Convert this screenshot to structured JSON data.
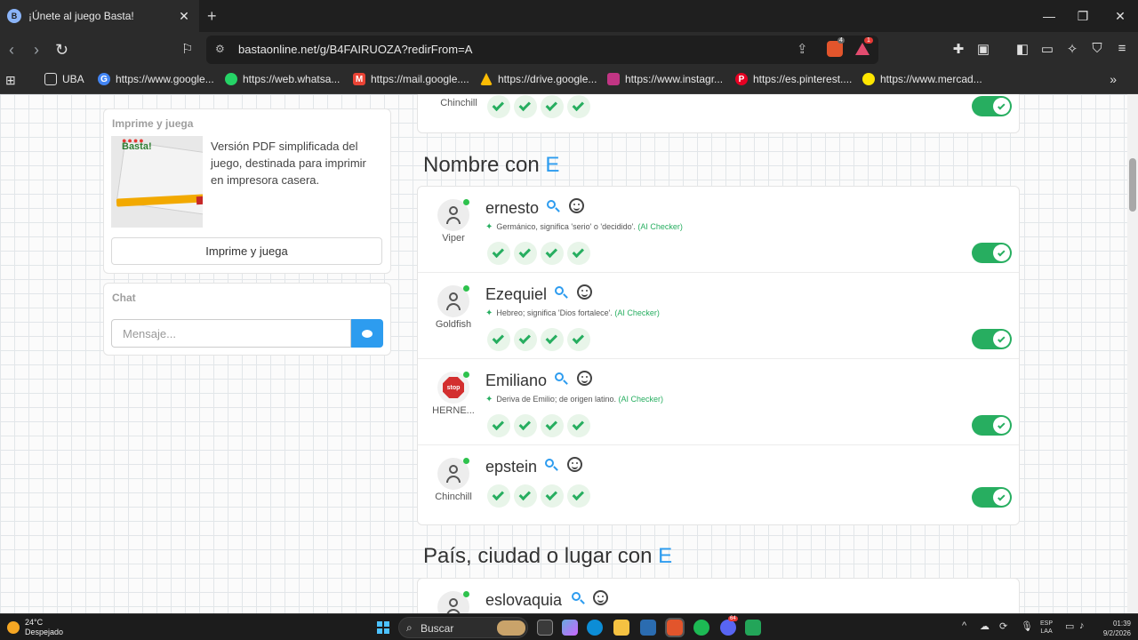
{
  "browser": {
    "tab_title": "¡Únete al juego Basta!",
    "tab_close": "✕",
    "new_tab": "+",
    "url": "bastaonline.net/g/B4FAIRUOZA?redirFrom=A",
    "brave_badge": "4",
    "rewards_badge": "1",
    "window_controls": {
      "minimize": "—",
      "maximize": "❐",
      "close": "✕"
    }
  },
  "bookmarks": [
    {
      "label": "UBA",
      "icon": "folder-icon",
      "color": "#9aa0a6"
    },
    {
      "label": "https://www.google...",
      "icon": "google-icon",
      "color": "#4285f4"
    },
    {
      "label": "https://web.whatsa...",
      "icon": "whatsapp-icon",
      "color": "#25d366"
    },
    {
      "label": "https://mail.google....",
      "icon": "gmail-icon",
      "color": "#ea4335"
    },
    {
      "label": "https://drive.google...",
      "icon": "drive-icon",
      "color": "#fbbc04"
    },
    {
      "label": "https://www.instagr...",
      "icon": "instagram-icon",
      "color": "#c13584"
    },
    {
      "label": "https://es.pinterest....",
      "icon": "pinterest-icon",
      "color": "#e60023"
    },
    {
      "label": "https://www.mercad...",
      "icon": "mercadolibre-icon",
      "color": "#ffe600"
    }
  ],
  "sidebar": {
    "print": {
      "label": "Imprime y juega",
      "description": "Versión PDF simplificada del juego, destinada para imprimir en impresora casera.",
      "button": "Imprime y juega",
      "thumb_logo": "Basta!",
      "thumb_dots": "●●●●"
    },
    "chat": {
      "label": "Chat",
      "placeholder": "Mensaje..."
    }
  },
  "top_partial_row": {
    "player": "Chinchill"
  },
  "sections": [
    {
      "title_prefix": "Nombre con",
      "letter": "E",
      "answers": [
        {
          "word": "ernesto",
          "player": "Viper",
          "ai_text": "Germánico, significa 'serio' o 'decidido'.",
          "ai_label": "(AI Checker)",
          "avatar": "user"
        },
        {
          "word": "Ezequiel",
          "player": "Goldfish",
          "ai_text": "Hebreo; significa 'Dios fortalece'.",
          "ai_label": "(AI Checker)",
          "avatar": "user"
        },
        {
          "word": "Emiliano",
          "player": "HERNE...",
          "ai_text": "Deriva de Emilio; de origen latino.",
          "ai_label": "(AI Checker)",
          "avatar": "stop"
        },
        {
          "word": "epstein",
          "player": "Chinchill",
          "ai_text": "",
          "ai_label": "",
          "avatar": "user"
        }
      ]
    },
    {
      "title_prefix": "País, ciudad o lugar con",
      "letter": "E",
      "answers": [
        {
          "word": "eslovaquia"
        }
      ]
    }
  ],
  "stop_label": "stop",
  "taskbar": {
    "temperature": "24°C",
    "weather": "Despejado",
    "search": "Buscar",
    "lang_top": "ESP",
    "lang_bottom": "LAA",
    "time": "01:39",
    "date": "9/2/2026",
    "discord_badge": "64"
  }
}
